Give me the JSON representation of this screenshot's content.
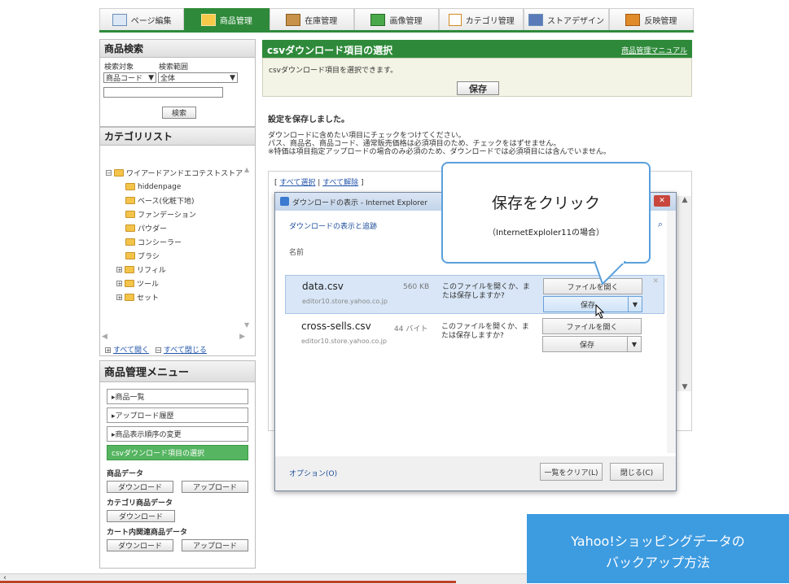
{
  "topnav": {
    "tabs": [
      {
        "label": "ページ編集",
        "icon": "page-edit-icon"
      },
      {
        "label": "商品管理",
        "icon": "product-icon",
        "active": true
      },
      {
        "label": "在庫管理",
        "icon": "inventory-icon"
      },
      {
        "label": "画像管理",
        "icon": "image-icon"
      },
      {
        "label": "カテゴリ管理",
        "icon": "category-icon"
      },
      {
        "label": "ストアデザイン",
        "icon": "store-design-icon"
      },
      {
        "label": "反映管理",
        "icon": "publish-icon"
      }
    ]
  },
  "search": {
    "title": "商品検索",
    "target_label": "検索対象",
    "range_label": "検索範囲",
    "target_value": "商品コード",
    "range_value": "全体",
    "button": "検索"
  },
  "category": {
    "title": "カテゴリリスト",
    "root": "ワイアードアンドエコテストストア",
    "items": [
      {
        "label": "hiddenpage",
        "expandable": false
      },
      {
        "label": "ベース(化粧下地)",
        "expandable": false
      },
      {
        "label": "ファンデーション",
        "expandable": false
      },
      {
        "label": "パウダー",
        "expandable": false
      },
      {
        "label": "コンシーラー",
        "expandable": false
      },
      {
        "label": "ブラシ",
        "expandable": false
      },
      {
        "label": "リフィル",
        "expandable": true
      },
      {
        "label": "ツール",
        "expandable": true
      },
      {
        "label": "セット",
        "expandable": true
      }
    ],
    "expand_all": "すべて開く",
    "collapse_all": "すべて閉じる"
  },
  "menu": {
    "title": "商品管理メニュー",
    "items": [
      {
        "label": "▸商品一覧"
      },
      {
        "label": "▸アップロード履歴"
      },
      {
        "label": "▸商品表示順序の変更"
      },
      {
        "label": "csvダウンロード項目の選択",
        "active": true
      }
    ],
    "product_data_label": "商品データ",
    "category_data_label": "カテゴリ商品データ",
    "cart_data_label": "カート内関連商品データ",
    "download": "ダウンロード",
    "upload": "アップロード"
  },
  "main": {
    "title": "csvダウンロード項目の選択",
    "manual_link": "商品管理マニュアル",
    "description": "csvダウンロード項目を選択できます。",
    "save_button": "保存",
    "saved_message": "設定を保存しました。",
    "instructions": [
      "ダウンロードに含めたい項目にチェックをつけてください。",
      "パス、商品名、商品コード、通常販売価格は必須項目のため、チェックをはずせません。",
      "※特価は項目指定アップロードの場合のみ必須のため、ダウンロードでは必須項目には含んでいません。"
    ],
    "select_all": "すべて選択",
    "deselect_all": "すべて解除"
  },
  "dialog": {
    "title": "ダウンロードの表示 - Internet Explorer",
    "subtitle": "ダウンロードの表示と追跡",
    "name_header": "名前",
    "files": [
      {
        "name": "data.csv",
        "size": "560 KB",
        "source": "editor10.store.yahoo.co.jp",
        "prompt": "このファイルを開くか、または保存しますか?",
        "open": "ファイルを開く",
        "save": "保存"
      },
      {
        "name": "cross-sells.csv",
        "size": "44 バイト",
        "source": "editor10.store.yahoo.co.jp",
        "prompt": "このファイルを開くか、または保存しますか?",
        "open": "ファイルを開く",
        "save": "保存"
      }
    ],
    "options_link": "オプション(O)",
    "clear_list": "一覧をクリア(L)",
    "close": "閉じる(C)"
  },
  "callout": {
    "title": "保存をクリック",
    "subtitle": "（InternetExploler11の場合）"
  },
  "banner": {
    "line1": "Yahoo!ショッピングデータの",
    "line2": "バックアップ方法"
  }
}
